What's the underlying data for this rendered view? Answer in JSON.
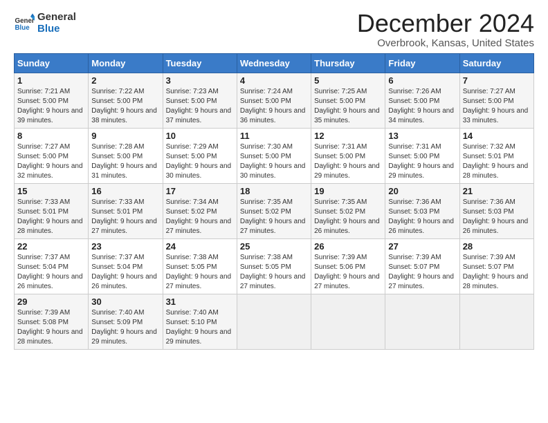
{
  "logo": {
    "text_general": "General",
    "text_blue": "Blue"
  },
  "header": {
    "month": "December 2024",
    "location": "Overbrook, Kansas, United States"
  },
  "weekdays": [
    "Sunday",
    "Monday",
    "Tuesday",
    "Wednesday",
    "Thursday",
    "Friday",
    "Saturday"
  ],
  "weeks": [
    [
      {
        "day": "1",
        "sunrise": "7:21 AM",
        "sunset": "5:00 PM",
        "daylight": "9 hours and 39 minutes."
      },
      {
        "day": "2",
        "sunrise": "7:22 AM",
        "sunset": "5:00 PM",
        "daylight": "9 hours and 38 minutes."
      },
      {
        "day": "3",
        "sunrise": "7:23 AM",
        "sunset": "5:00 PM",
        "daylight": "9 hours and 37 minutes."
      },
      {
        "day": "4",
        "sunrise": "7:24 AM",
        "sunset": "5:00 PM",
        "daylight": "9 hours and 36 minutes."
      },
      {
        "day": "5",
        "sunrise": "7:25 AM",
        "sunset": "5:00 PM",
        "daylight": "9 hours and 35 minutes."
      },
      {
        "day": "6",
        "sunrise": "7:26 AM",
        "sunset": "5:00 PM",
        "daylight": "9 hours and 34 minutes."
      },
      {
        "day": "7",
        "sunrise": "7:27 AM",
        "sunset": "5:00 PM",
        "daylight": "9 hours and 33 minutes."
      }
    ],
    [
      {
        "day": "8",
        "sunrise": "7:27 AM",
        "sunset": "5:00 PM",
        "daylight": "9 hours and 32 minutes."
      },
      {
        "day": "9",
        "sunrise": "7:28 AM",
        "sunset": "5:00 PM",
        "daylight": "9 hours and 31 minutes."
      },
      {
        "day": "10",
        "sunrise": "7:29 AM",
        "sunset": "5:00 PM",
        "daylight": "9 hours and 30 minutes."
      },
      {
        "day": "11",
        "sunrise": "7:30 AM",
        "sunset": "5:00 PM",
        "daylight": "9 hours and 30 minutes."
      },
      {
        "day": "12",
        "sunrise": "7:31 AM",
        "sunset": "5:00 PM",
        "daylight": "9 hours and 29 minutes."
      },
      {
        "day": "13",
        "sunrise": "7:31 AM",
        "sunset": "5:00 PM",
        "daylight": "9 hours and 29 minutes."
      },
      {
        "day": "14",
        "sunrise": "7:32 AM",
        "sunset": "5:01 PM",
        "daylight": "9 hours and 28 minutes."
      }
    ],
    [
      {
        "day": "15",
        "sunrise": "7:33 AM",
        "sunset": "5:01 PM",
        "daylight": "9 hours and 28 minutes."
      },
      {
        "day": "16",
        "sunrise": "7:33 AM",
        "sunset": "5:01 PM",
        "daylight": "9 hours and 27 minutes."
      },
      {
        "day": "17",
        "sunrise": "7:34 AM",
        "sunset": "5:02 PM",
        "daylight": "9 hours and 27 minutes."
      },
      {
        "day": "18",
        "sunrise": "7:35 AM",
        "sunset": "5:02 PM",
        "daylight": "9 hours and 27 minutes."
      },
      {
        "day": "19",
        "sunrise": "7:35 AM",
        "sunset": "5:02 PM",
        "daylight": "9 hours and 26 minutes."
      },
      {
        "day": "20",
        "sunrise": "7:36 AM",
        "sunset": "5:03 PM",
        "daylight": "9 hours and 26 minutes."
      },
      {
        "day": "21",
        "sunrise": "7:36 AM",
        "sunset": "5:03 PM",
        "daylight": "9 hours and 26 minutes."
      }
    ],
    [
      {
        "day": "22",
        "sunrise": "7:37 AM",
        "sunset": "5:04 PM",
        "daylight": "9 hours and 26 minutes."
      },
      {
        "day": "23",
        "sunrise": "7:37 AM",
        "sunset": "5:04 PM",
        "daylight": "9 hours and 26 minutes."
      },
      {
        "day": "24",
        "sunrise": "7:38 AM",
        "sunset": "5:05 PM",
        "daylight": "9 hours and 27 minutes."
      },
      {
        "day": "25",
        "sunrise": "7:38 AM",
        "sunset": "5:05 PM",
        "daylight": "9 hours and 27 minutes."
      },
      {
        "day": "26",
        "sunrise": "7:39 AM",
        "sunset": "5:06 PM",
        "daylight": "9 hours and 27 minutes."
      },
      {
        "day": "27",
        "sunrise": "7:39 AM",
        "sunset": "5:07 PM",
        "daylight": "9 hours and 27 minutes."
      },
      {
        "day": "28",
        "sunrise": "7:39 AM",
        "sunset": "5:07 PM",
        "daylight": "9 hours and 28 minutes."
      }
    ],
    [
      {
        "day": "29",
        "sunrise": "7:39 AM",
        "sunset": "5:08 PM",
        "daylight": "9 hours and 28 minutes."
      },
      {
        "day": "30",
        "sunrise": "7:40 AM",
        "sunset": "5:09 PM",
        "daylight": "9 hours and 29 minutes."
      },
      {
        "day": "31",
        "sunrise": "7:40 AM",
        "sunset": "5:10 PM",
        "daylight": "9 hours and 29 minutes."
      },
      null,
      null,
      null,
      null
    ]
  ],
  "labels": {
    "sunrise": "Sunrise:",
    "sunset": "Sunset:",
    "daylight": "Daylight:"
  }
}
